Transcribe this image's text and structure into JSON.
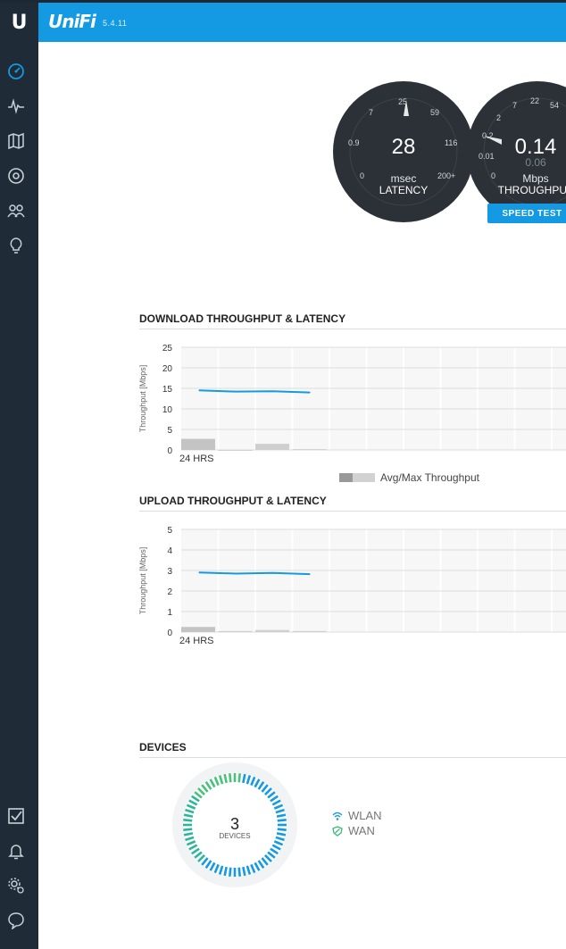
{
  "app": {
    "brand": "UniFi",
    "version": "5.4.11"
  },
  "sidebar": {
    "top_items": [
      {
        "icon": "dashboard-icon"
      },
      {
        "icon": "statistics-icon"
      },
      {
        "icon": "map-icon"
      },
      {
        "icon": "devices-icon"
      },
      {
        "icon": "clients-icon"
      },
      {
        "icon": "insights-icon"
      }
    ],
    "bottom_items": [
      {
        "icon": "events-icon"
      },
      {
        "icon": "alerts-icon"
      },
      {
        "icon": "settings-icon"
      },
      {
        "icon": "chat-icon"
      }
    ]
  },
  "latency_gauge": {
    "value": "28",
    "unit": "msec",
    "label": "LATENCY",
    "ticks": [
      "0",
      "0.9",
      "7",
      "25",
      "59",
      "116",
      "200+"
    ]
  },
  "throughput_gauge": {
    "value": "0.14",
    "secondary": "0.06",
    "unit": "Mbps",
    "label": "THROUGHPUT",
    "ticks": [
      "0",
      "0.01",
      "0.2",
      "2",
      "7",
      "22",
      "54"
    ]
  },
  "speed_test_button": "SPEED TEST",
  "download": {
    "title": "DOWNLOAD THROUGHPUT & LATENCY",
    "y_axis_label": "Throughput [Mbps]",
    "x_label": "24 HRS",
    "legend": "Avg/Max Throughput"
  },
  "upload": {
    "title": "UPLOAD THROUGHPUT & LATENCY",
    "y_axis_label": "Throughput [Mbps]",
    "x_label": "24 HRS"
  },
  "devices": {
    "title": "DEVICES",
    "count": "3",
    "count_label": "DEVICES",
    "legend": [
      {
        "icon": "wifi-icon",
        "label": "WLAN",
        "color": "#139ae2"
      },
      {
        "icon": "shield-icon",
        "label": "WAN",
        "color": "#3cb878"
      }
    ]
  },
  "chart_data": [
    {
      "type": "bar",
      "title": "DOWNLOAD THROUGHPUT & LATENCY",
      "ylabel": "Throughput [Mbps]",
      "xlabel": "24 HRS",
      "ylim": [
        0,
        25
      ],
      "yticks": [
        0,
        5,
        10,
        15,
        20,
        25
      ],
      "series": [
        {
          "name": "Avg/Max Throughput",
          "values": [
            2.7,
            0.0,
            1.5,
            0.2
          ]
        },
        {
          "values": [
            14.5,
            14.2,
            14.3,
            14.0
          ]
        }
      ]
    },
    {
      "type": "bar",
      "title": "UPLOAD THROUGHPUT & LATENCY",
      "ylabel": "Throughput [Mbps]",
      "xlabel": "24 HRS",
      "ylim": [
        0,
        5
      ],
      "yticks": [
        0,
        1,
        2,
        3,
        4,
        5
      ],
      "series": [
        {
          "name": "Avg/Max Throughput",
          "values": [
            0.25,
            0.05,
            0.1,
            0.05
          ]
        },
        {
          "values": [
            2.9,
            2.85,
            2.88,
            2.82
          ]
        }
      ]
    }
  ]
}
